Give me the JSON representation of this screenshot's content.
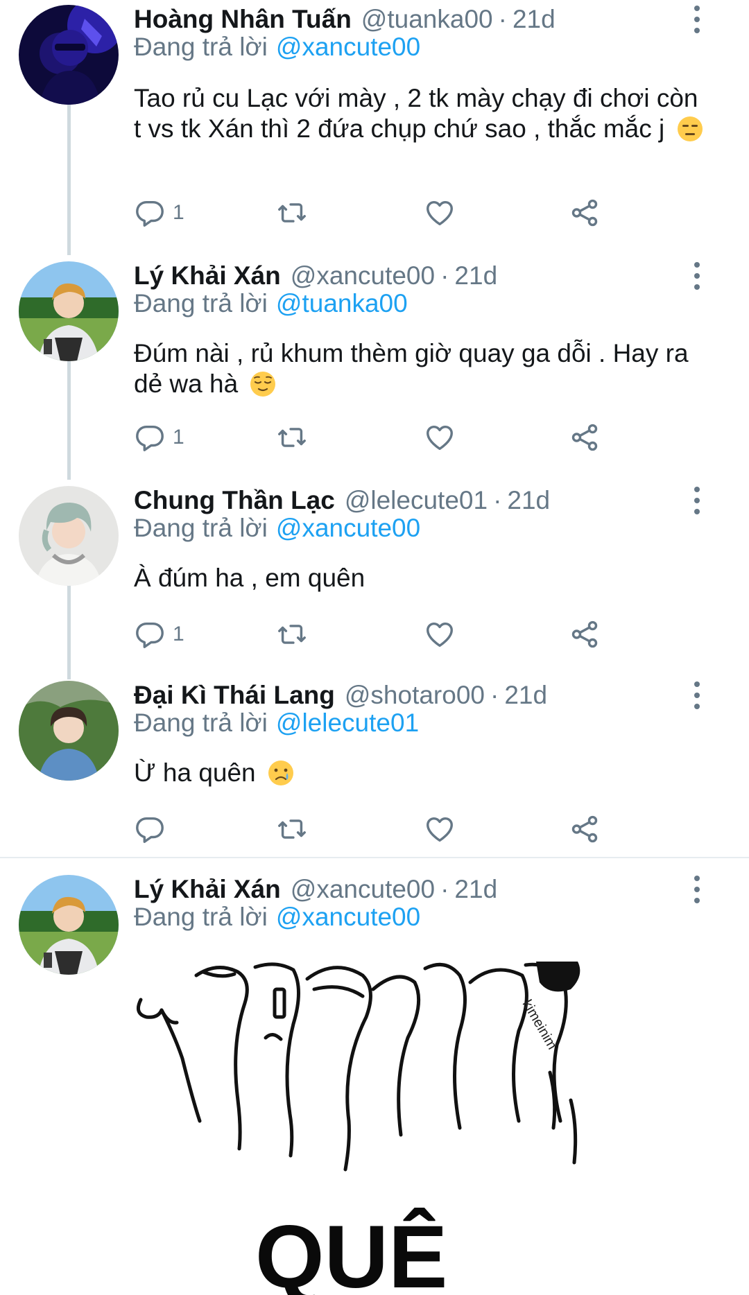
{
  "reply_prefix": "Đang trả lời",
  "tweets": [
    {
      "name": "Hoàng Nhân Tuấn",
      "handle": "@tuanka00",
      "time": "21d",
      "reply_to": "@xancute00",
      "text": "Tao rủ cu Lạc với mày , 2 tk mày chạy đi chơi còn t vs tk Xán thì 2 đứa chụp chứ sao , thắc mắc j",
      "emoji": "expressionless-face-emoji",
      "reply_count": "1"
    },
    {
      "name": "Lý Khải Xán",
      "handle": "@xancute00",
      "time": "21d",
      "reply_to": "@tuanka00",
      "text": "Đúm nài , rủ khum thèm giờ quay ga dỗi . Hay ra dẻ wa hà",
      "emoji": "relieved-face-emoji",
      "reply_count": "1"
    },
    {
      "name": "Chung Thần Lạc",
      "handle": "@lelecute01",
      "time": "21d",
      "reply_to": "@xancute00",
      "text": "À đúm ha  , em quên",
      "reply_count": "1"
    },
    {
      "name": "Đại Kì Thái Lang",
      "handle": "@shotaro00",
      "time": "21d",
      "reply_to": "@lelecute01",
      "text": "Ừ ha quên",
      "emoji": "crying-face-emoji",
      "reply_count": ""
    },
    {
      "name": "Lý Khải Xán",
      "handle": "@xancute00",
      "time": "21d",
      "reply_to": "@xancute00",
      "media_caption": "QUÊ",
      "media_watermark": "kimeinim"
    }
  ],
  "colors": {
    "text": "#14171a",
    "secondary": "#657786",
    "link": "#1da1f2",
    "thread_line": "#cfd9de",
    "separator": "#e6ecf0"
  },
  "icons": [
    "reply-icon",
    "retweet-icon",
    "like-icon",
    "share-icon",
    "more-options-icon"
  ]
}
